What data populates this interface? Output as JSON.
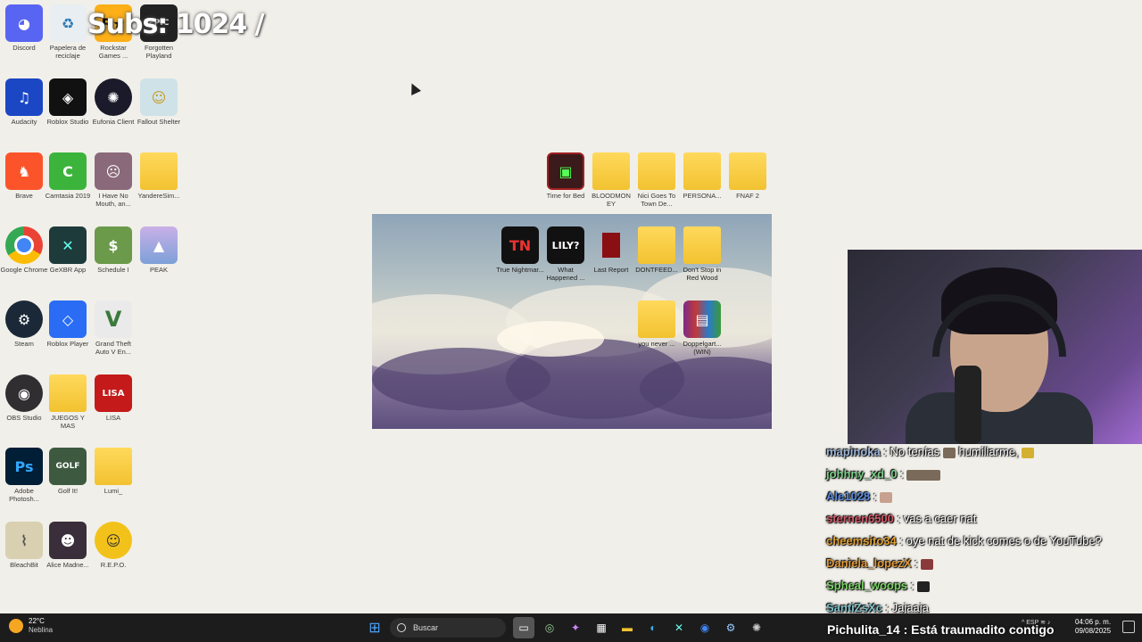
{
  "overlay": {
    "subs": "Subs: 1024 /"
  },
  "desktop_icons": {
    "discord": "Discord",
    "recycle": "Papelera de reciclaje",
    "rockstar": "Rockstar Games ...",
    "forgotten": "Forgotten Playland",
    "audacity": "Audacity",
    "roblox_studio": "Roblox Studio",
    "eufonia": "Eufonia Client",
    "fallout": "Fallout Shelter",
    "brave": "Brave",
    "camtasia": "Camtasia 2019",
    "ihavenomouth": "I Have No Mouth, an...",
    "yandere": "YandereSim...",
    "chrome": "Google Chrome",
    "xbox": "GeXBR App",
    "schedule": "Schedule I",
    "peak": "PEAK",
    "steam": "Steam",
    "roblox_player": "Roblox Player",
    "gta": "Grand Theft Auto V En...",
    "obs": "OBS Studio",
    "juegos": "JUEGOS Y MAS",
    "lisa": "LISA",
    "photoshop": "Adobe Photosh...",
    "golfit": "Golf It!",
    "lumi": "Lumi_",
    "bleachbit": "BleachBit",
    "alice": "Alice Madne...",
    "repo": "R.E.P.O.",
    "timeforbed": "Time for Bed",
    "bloodmoney": "BLOODMON EY",
    "nicigoes": "Nici Goes To Town De...",
    "persona": "PERSONA...",
    "fnaf": "FNAF 2",
    "tn": "True Nightmar...",
    "lily": "What Happened ...",
    "lastreport": "Last Report",
    "dontfeed": "DONTFEED...",
    "dontstop": "Don't Stop in Red Wood",
    "younever": "you never ...",
    "doppel": "Doppelgart... (WIN)"
  },
  "chat": [
    {
      "user": "mapinoka",
      "text": "No tenías",
      "text2": "humillarme,",
      "color": "#9fb6d8",
      "emote": true
    },
    {
      "user": "johhny_xd_0",
      "text": "",
      "color": "#7dcf8a",
      "emote_wide": true
    },
    {
      "user": "Ale1028",
      "text": "",
      "color": "#5b8dde",
      "emote": true
    },
    {
      "user": "sternen6500",
      "text": "vas a caer nat",
      "color": "#d05a6a"
    },
    {
      "user": "cheemsito34",
      "text": "oye nat de kick comes o de YouTube?",
      "color": "#e0a032"
    },
    {
      "user": "Daniela_lopezX",
      "text": "",
      "color": "#e09a3a",
      "emote": true
    },
    {
      "user": "Spheal_woops",
      "text": "",
      "color": "#7dd36a",
      "emote": true
    },
    {
      "user": "SantiZsXc",
      "text": "Jajaaja",
      "color": "#7fc0c8"
    }
  ],
  "bottom_chat": "Pichulita_14 : Está traumadito contigo",
  "taskbar": {
    "temp": "22°C",
    "weather": "Neblina",
    "search_placeholder": "Buscar",
    "lang": "ESP",
    "time": "04:06 p. m.",
    "date": "09/08/2025"
  }
}
